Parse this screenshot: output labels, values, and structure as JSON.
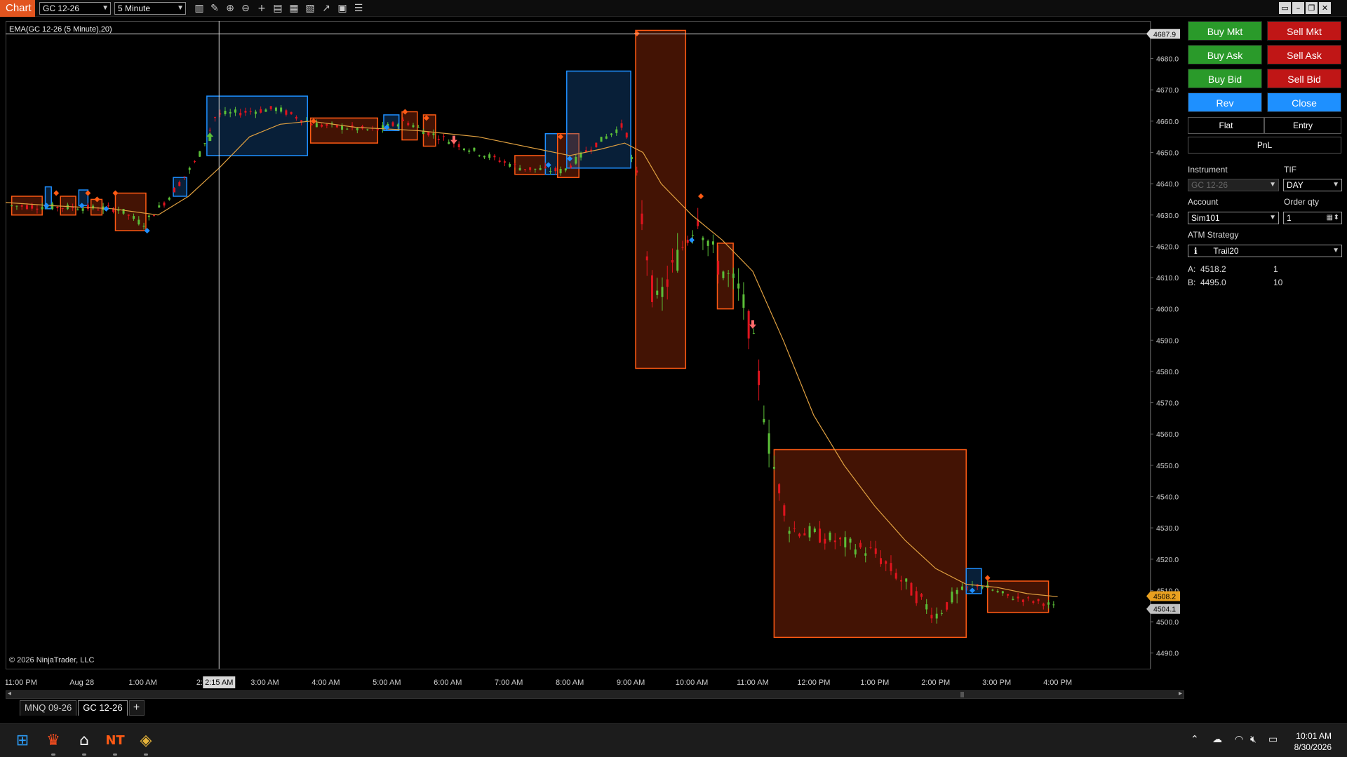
{
  "titlebar": {
    "app_label": "Chart",
    "instrument": "GC 12-26",
    "interval": "5 Minute"
  },
  "chart": {
    "indicator_label": "EMA(GC 12-26 (5 Minute),20)",
    "copyright": "© 2026 NinjaTrader, LLC",
    "crosshair_time": "2:15 AM",
    "crosshair_price": "4687.9",
    "last_price": "4508.2",
    "ema_price": "4504.1"
  },
  "chart_data": {
    "type": "candlestick",
    "instrument": "GC 12-26",
    "interval": "5 Minute",
    "ylim": [
      4485,
      4692
    ],
    "y_ticks": [
      4490.0,
      4500.0,
      4510.0,
      4520.0,
      4530.0,
      4540.0,
      4550.0,
      4560.0,
      4570.0,
      4580.0,
      4590.0,
      4600.0,
      4610.0,
      4620.0,
      4630.0,
      4640.0,
      4650.0,
      4660.0,
      4670.0,
      4680.0
    ],
    "x_ticks": [
      "11:00 PM",
      "Aug 28",
      "1:00 AM",
      "2:00",
      "3:00 AM",
      "4:00 AM",
      "5:00 AM",
      "6:00 AM",
      "7:00 AM",
      "8:00 AM",
      "9:00 AM",
      "10:00 AM",
      "11:00 AM",
      "12:00 PM",
      "1:00 PM",
      "2:00 PM",
      "3:00 PM",
      "4:00 PM"
    ],
    "x_tick_hours": [
      23.0,
      24.0,
      25.0,
      26.0,
      27.0,
      28.0,
      29.0,
      30.0,
      31.0,
      32.0,
      33.0,
      34.0,
      35.0,
      36.0,
      37.0,
      38.0,
      39.0,
      40.0
    ],
    "xlim_hours": [
      22.75,
      41.5
    ],
    "crosshair_hour": 26.25,
    "ema_period": 20,
    "ema": [
      [
        22.75,
        4634
      ],
      [
        23.5,
        4633
      ],
      [
        24.5,
        4632
      ],
      [
        25.25,
        4630
      ],
      [
        25.75,
        4636
      ],
      [
        26.25,
        4645
      ],
      [
        26.75,
        4655
      ],
      [
        27.25,
        4659
      ],
      [
        27.75,
        4660
      ],
      [
        28.5,
        4658
      ],
      [
        29.5,
        4657
      ],
      [
        30.5,
        4655
      ],
      [
        31.5,
        4651
      ],
      [
        32.0,
        4649
      ],
      [
        32.5,
        4651
      ],
      [
        32.9,
        4653
      ],
      [
        33.2,
        4650
      ],
      [
        33.5,
        4640
      ],
      [
        34.0,
        4630
      ],
      [
        34.5,
        4622
      ],
      [
        35.0,
        4612
      ],
      [
        35.5,
        4590
      ],
      [
        36.0,
        4566
      ],
      [
        36.5,
        4550
      ],
      [
        37.0,
        4537
      ],
      [
        37.5,
        4526
      ],
      [
        38.0,
        4517
      ],
      [
        38.5,
        4512
      ],
      [
        39.0,
        4511
      ],
      [
        39.5,
        4509
      ],
      [
        40.0,
        4508
      ]
    ],
    "zones": [
      {
        "t0": 22.85,
        "t1": 23.35,
        "top": 4636,
        "bottom": 4630,
        "kind": "bear"
      },
      {
        "t0": 23.4,
        "t1": 23.5,
        "top": 4639,
        "bottom": 4632,
        "kind": "bull"
      },
      {
        "t0": 23.65,
        "t1": 23.9,
        "top": 4636,
        "bottom": 4630,
        "kind": "bear"
      },
      {
        "t0": 23.95,
        "t1": 24.1,
        "top": 4638,
        "bottom": 4633,
        "kind": "bull"
      },
      {
        "t0": 24.15,
        "t1": 24.33,
        "top": 4635,
        "bottom": 4630,
        "kind": "bear"
      },
      {
        "t0": 24.55,
        "t1": 25.05,
        "top": 4637,
        "bottom": 4625,
        "kind": "bear"
      },
      {
        "t0": 25.5,
        "t1": 25.72,
        "top": 4642,
        "bottom": 4636,
        "kind": "bull"
      },
      {
        "t0": 26.05,
        "t1": 27.7,
        "top": 4668,
        "bottom": 4649,
        "kind": "bull"
      },
      {
        "t0": 27.75,
        "t1": 28.85,
        "top": 4661,
        "bottom": 4653,
        "kind": "bear"
      },
      {
        "t0": 28.95,
        "t1": 29.2,
        "top": 4662,
        "bottom": 4657,
        "kind": "bull"
      },
      {
        "t0": 29.25,
        "t1": 29.5,
        "top": 4663,
        "bottom": 4654,
        "kind": "bear"
      },
      {
        "t0": 29.6,
        "t1": 29.8,
        "top": 4662,
        "bottom": 4652,
        "kind": "bear"
      },
      {
        "t0": 31.1,
        "t1": 31.6,
        "top": 4649,
        "bottom": 4643,
        "kind": "bear"
      },
      {
        "t0": 31.6,
        "t1": 31.8,
        "top": 4656,
        "bottom": 4643,
        "kind": "bull"
      },
      {
        "t0": 31.8,
        "t1": 32.15,
        "top": 4656,
        "bottom": 4642,
        "kind": "bear"
      },
      {
        "t0": 31.95,
        "t1": 33.0,
        "top": 4676,
        "bottom": 4645,
        "kind": "bull"
      },
      {
        "t0": 33.08,
        "t1": 33.9,
        "top": 4689,
        "bottom": 4581,
        "kind": "bear"
      },
      {
        "t0": 34.42,
        "t1": 34.68,
        "top": 4621,
        "bottom": 4600,
        "kind": "bear"
      },
      {
        "t0": 35.35,
        "t1": 38.5,
        "top": 4555,
        "bottom": 4495,
        "kind": "bear"
      },
      {
        "t0": 38.5,
        "t1": 38.75,
        "top": 4517,
        "bottom": 4509,
        "kind": "bull"
      },
      {
        "t0": 38.85,
        "t1": 39.85,
        "top": 4513,
        "bottom": 4503,
        "kind": "bear"
      }
    ],
    "markers": [
      {
        "t": 23.42,
        "p": 4633,
        "kind": "buy"
      },
      {
        "t": 23.58,
        "p": 4637,
        "kind": "sell"
      },
      {
        "t": 24.0,
        "p": 4633,
        "kind": "buy"
      },
      {
        "t": 24.1,
        "p": 4637,
        "kind": "sell"
      },
      {
        "t": 24.25,
        "p": 4635,
        "kind": "sell"
      },
      {
        "t": 24.4,
        "p": 4632,
        "kind": "buy"
      },
      {
        "t": 24.55,
        "p": 4637,
        "kind": "sell"
      },
      {
        "t": 25.07,
        "p": 4625,
        "kind": "buy"
      },
      {
        "t": 27.8,
        "p": 4660,
        "kind": "sell"
      },
      {
        "t": 29.0,
        "p": 4658,
        "kind": "buy"
      },
      {
        "t": 29.3,
        "p": 4663,
        "kind": "sell"
      },
      {
        "t": 29.65,
        "p": 4661,
        "kind": "sell"
      },
      {
        "t": 31.65,
        "p": 4646,
        "kind": "buy"
      },
      {
        "t": 32.0,
        "p": 4648,
        "kind": "buy"
      },
      {
        "t": 31.85,
        "p": 4655,
        "kind": "sell"
      },
      {
        "t": 33.1,
        "p": 4688,
        "kind": "sell"
      },
      {
        "t": 34.0,
        "p": 4622,
        "kind": "buy"
      },
      {
        "t": 34.15,
        "p": 4636,
        "kind": "sell"
      },
      {
        "t": 38.6,
        "p": 4510,
        "kind": "buy"
      },
      {
        "t": 38.85,
        "p": 4514,
        "kind": "sell"
      }
    ],
    "arrows": [
      {
        "t": 26.1,
        "p": 4655,
        "dir": "up"
      },
      {
        "t": 30.1,
        "p": 4654,
        "dir": "down"
      },
      {
        "t": 35.0,
        "p": 4595,
        "dir": "down"
      }
    ]
  },
  "tabs": [
    {
      "label": "MNQ 09-26",
      "active": false
    },
    {
      "label": "GC 12-26",
      "active": true
    }
  ],
  "tab_add": "+",
  "order_panel": {
    "buy_mkt": "Buy Mkt",
    "sell_mkt": "Sell Mkt",
    "buy_ask": "Buy Ask",
    "sell_ask": "Sell Ask",
    "buy_bid": "Buy Bid",
    "sell_bid": "Sell Bid",
    "rev": "Rev",
    "close": "Close",
    "flat": "Flat",
    "entry": "Entry",
    "pnl": "PnL",
    "instrument_label": "Instrument",
    "instrument_value": "GC 12-26",
    "tif_label": "TIF",
    "tif_value": "DAY",
    "account_label": "Account",
    "account_value": "Sim101",
    "order_qty_label": "Order qty",
    "order_qty_value": "1",
    "atm_label": "ATM Strategy",
    "atm_value": "Trail20",
    "ask_label": "A:",
    "ask_price": "4518.2",
    "ask_size": "1",
    "bid_label": "B:",
    "bid_price": "4495.0",
    "bid_size": "10"
  },
  "taskbar": {
    "time": "10:01 AM",
    "date": "8/30/2026",
    "icons": [
      "windows-start-icon",
      "brave-browser-icon",
      "bank-icon",
      "ninjatrader-icon",
      "git-icon"
    ],
    "tray": [
      "chevron-up-icon",
      "cloud-icon",
      "wifi-icon",
      "volume-mute-icon",
      "battery-icon"
    ]
  },
  "colors": {
    "bull": "#1e8fff",
    "bear": "#ff5a14",
    "candle_up": "#5bbf38",
    "candle_down": "#e0141e",
    "ema": "#e0a040",
    "app_accent": "#e2551f"
  }
}
